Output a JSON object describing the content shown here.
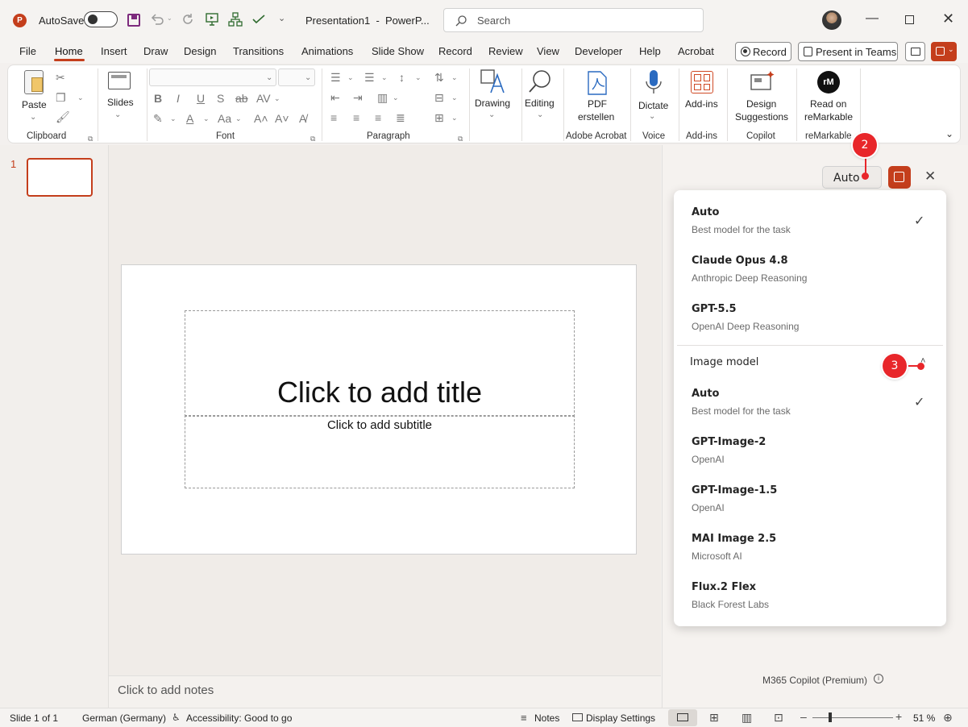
{
  "titlebar": {
    "autosave_label": "AutoSave",
    "title": "Presentation1  -  PowerP...",
    "search_placeholder": "Search"
  },
  "menu": [
    "File",
    "Home",
    "Insert",
    "Draw",
    "Design",
    "Transitions",
    "Animations",
    "Slide Show",
    "Record",
    "Review",
    "View",
    "Developer",
    "Help",
    "Acrobat"
  ],
  "menu_right": {
    "record_label": "Record",
    "present_label": "Present in Teams"
  },
  "ribbon": {
    "paste_label": "Paste",
    "slides_label": "Slides",
    "drawing_label": "Drawing",
    "editing_label": "Editing",
    "pdf_label_1": "PDF",
    "pdf_label_2": "erstellen",
    "dictate_label": "Dictate",
    "addins_label": "Add-ins",
    "design_label_1": "Design",
    "design_label_2": "Suggestions",
    "read_label_1": "Read on",
    "read_label_2": "reMarkable",
    "remarkable_logo": "rM",
    "font_bold": "B",
    "font_italic": "I",
    "font_underline": "U",
    "font_strike": "S",
    "font_ab": "ab",
    "font_av": "AV",
    "font_aa": "Aa",
    "font_a": "A",
    "groups": {
      "clipboard": "Clipboard",
      "font": "Font",
      "paragraph": "Paragraph",
      "adobe": "Adobe Acrobat",
      "voice": "Voice",
      "addins": "Add-ins",
      "copilot": "Copilot",
      "remarkable": "reMarkable"
    }
  },
  "thumbnail": {
    "number": "1"
  },
  "slide": {
    "title_placeholder": "Click to add title",
    "subtitle_placeholder": "Click to add subtitle"
  },
  "notes_placeholder": "Click to add notes",
  "panel": {
    "model_button": "Auto",
    "footer": "M365 Copilot (Premium)",
    "text_models": [
      {
        "name": "Auto",
        "desc": "Best model for the task",
        "selected": true
      },
      {
        "name": "Claude Opus 4.8",
        "desc": "Anthropic Deep Reasoning",
        "selected": false
      },
      {
        "name": "GPT-5.5",
        "desc": "OpenAI Deep Reasoning",
        "selected": false
      }
    ],
    "image_section": "Image model",
    "image_models": [
      {
        "name": "Auto",
        "desc": "Best model for the task",
        "selected": true
      },
      {
        "name": "GPT-Image-2",
        "desc": "OpenAI",
        "selected": false
      },
      {
        "name": "GPT-Image-1.5",
        "desc": "OpenAI",
        "selected": false
      },
      {
        "name": "MAI Image 2.5",
        "desc": "Microsoft AI",
        "selected": false
      },
      {
        "name": "Flux.2 Flex",
        "desc": "Black Forest Labs",
        "selected": false
      }
    ]
  },
  "annotations": {
    "badge_2": "2",
    "badge_3": "3"
  },
  "statusbar": {
    "slide_info": "Slide 1 of 1",
    "language": "German (Germany)",
    "accessibility": "Accessibility: Good to go",
    "notes": "Notes",
    "display": "Display Settings",
    "zoom": "51 %"
  },
  "colors": {
    "accent": "#c43e1c",
    "badge": "#e8262a"
  }
}
